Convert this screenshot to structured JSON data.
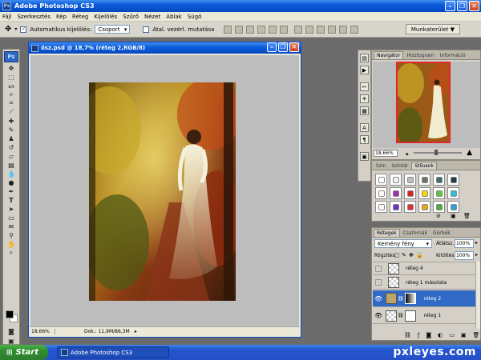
{
  "app": {
    "title": "Adobe Photoshop CS3",
    "ps_icon": "Ps"
  },
  "menu": [
    "Fájl",
    "Szerkesztés",
    "Kép",
    "Réteg",
    "Kijelölés",
    "Szűrő",
    "Nézet",
    "Ablak",
    "Súgó"
  ],
  "options": {
    "auto_select_label": "Automatikus kijelölés:",
    "auto_select_value": "Csoport",
    "transform_label": "Átal. vezérl. mutatása",
    "workspace_label": "Munkaterület ▼"
  },
  "document": {
    "title": "ősz.psd @ 18,7% (réteg 2,RGB/8)",
    "zoom": "18,66%",
    "doc_info": "Dok.: 11,9M/86,3M"
  },
  "navigator": {
    "tabs": [
      "Navigátor",
      "Hisztogram",
      "Információ"
    ],
    "zoom": "18,66%"
  },
  "styles": {
    "tabs": [
      "Szín",
      "Színtár",
      "Stílusok"
    ],
    "colors": [
      "#ffffff",
      "#f2f2f2",
      "#bdbdbd",
      "#6f6f6f",
      "#3d6b6b",
      "#22384b",
      "#ffffff",
      "#9c2fb0",
      "#d92222",
      "#ffd400",
      "#5ac83c",
      "#2fc0d6",
      "#ffffff",
      "#6d2fd0",
      "#e52d2d",
      "#f0a810",
      "#4ab03a",
      "#2f9fd8"
    ]
  },
  "layers": {
    "tabs": [
      "Rétegek",
      "Csatornák",
      "Görbék"
    ],
    "blend_mode": "Kemény fény",
    "opacity_label": "Átlátsz.:",
    "opacity_value": "100%",
    "lock_label": "Rögzítés:",
    "fill_label": "Kitöltés:",
    "fill_value": "100%",
    "items": [
      {
        "name": "réteg 4",
        "visible": false
      },
      {
        "name": "réteg 1 másolata",
        "visible": false
      },
      {
        "name": "réteg 2",
        "visible": true
      },
      {
        "name": "réteg 1",
        "visible": true
      }
    ]
  },
  "taskbar": {
    "start": "Start",
    "task": "Adobe Photoshop CS3",
    "watermark": "pxleyes.com"
  }
}
